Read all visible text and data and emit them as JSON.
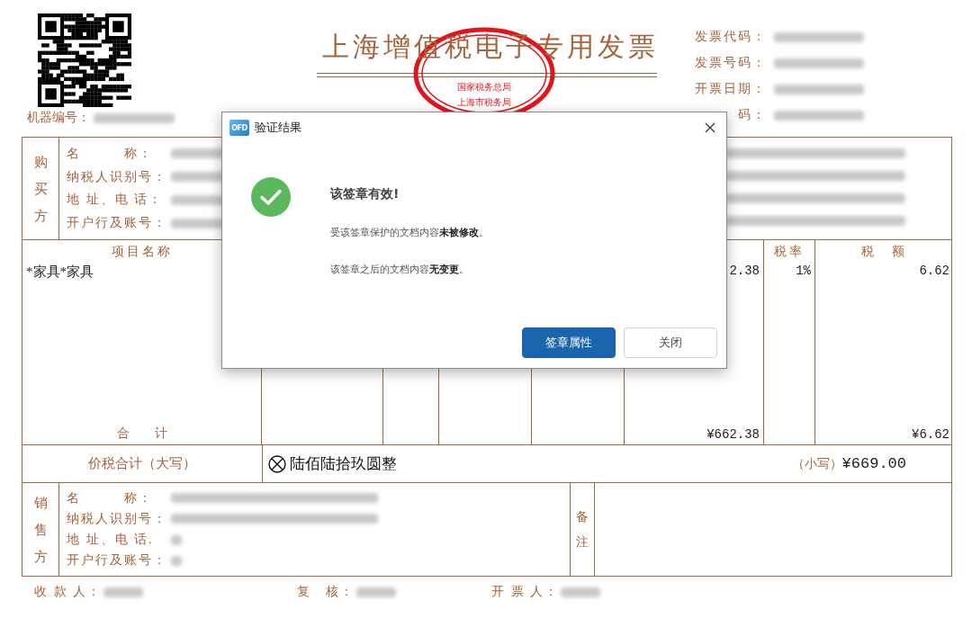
{
  "invoice": {
    "title": "上海增值税电子专用发票",
    "seal_lines": [
      "国家税务总局",
      "上海市税务局"
    ],
    "machine_number_label": "机器编号：",
    "header_fields": [
      {
        "label": "发票代码："
      },
      {
        "label": "发票号码："
      },
      {
        "label": "开票日期："
      },
      {
        "label": "码："
      }
    ],
    "buyer": {
      "side_label": "购买方",
      "fields": [
        {
          "label": "名　　　称："
        },
        {
          "label": "纳税人识别号："
        },
        {
          "label": "地 址、电 话："
        },
        {
          "label": "开户行及账号："
        }
      ]
    },
    "items": {
      "columns": [
        {
          "kind": "name",
          "header": "项目名称",
          "row": "*家具*家具",
          "total": "合　　计"
        },
        {
          "kind": "amount",
          "row": "2.38",
          "total": "¥662.38"
        },
        {
          "kind": "rate",
          "header": "税率",
          "row": "1%"
        },
        {
          "kind": "tax",
          "header": "税　额",
          "row": "6.62",
          "total": "¥6.62"
        }
      ]
    },
    "grand_total": {
      "label": "价税合计（大写）",
      "words": "陆佰陆拾玖圆整",
      "small_label": "（小写）",
      "amount": "¥669.00"
    },
    "seller": {
      "side_label": "销售方",
      "fields": [
        {
          "label": "名　　　称："
        },
        {
          "label": "纳税人识别号："
        },
        {
          "label": "地 址、电 话."
        },
        {
          "label": "开户行及账号："
        }
      ]
    },
    "remarks_label": "备注",
    "footer": [
      {
        "label": "收 款 人："
      },
      {
        "label": "复　核："
      },
      {
        "label": "开 票 人："
      }
    ]
  },
  "dialog": {
    "title": "验证结果",
    "icon_label": "OFD",
    "heading": "该签章有效!",
    "lines": [
      "受该签章保护的文档内容**未被修改**。",
      "该签章之后的文档内容**无变更**。"
    ],
    "buttons": [
      {
        "label": "签章属性",
        "primary": true
      },
      {
        "label": "关闭",
        "primary": false
      }
    ]
  }
}
